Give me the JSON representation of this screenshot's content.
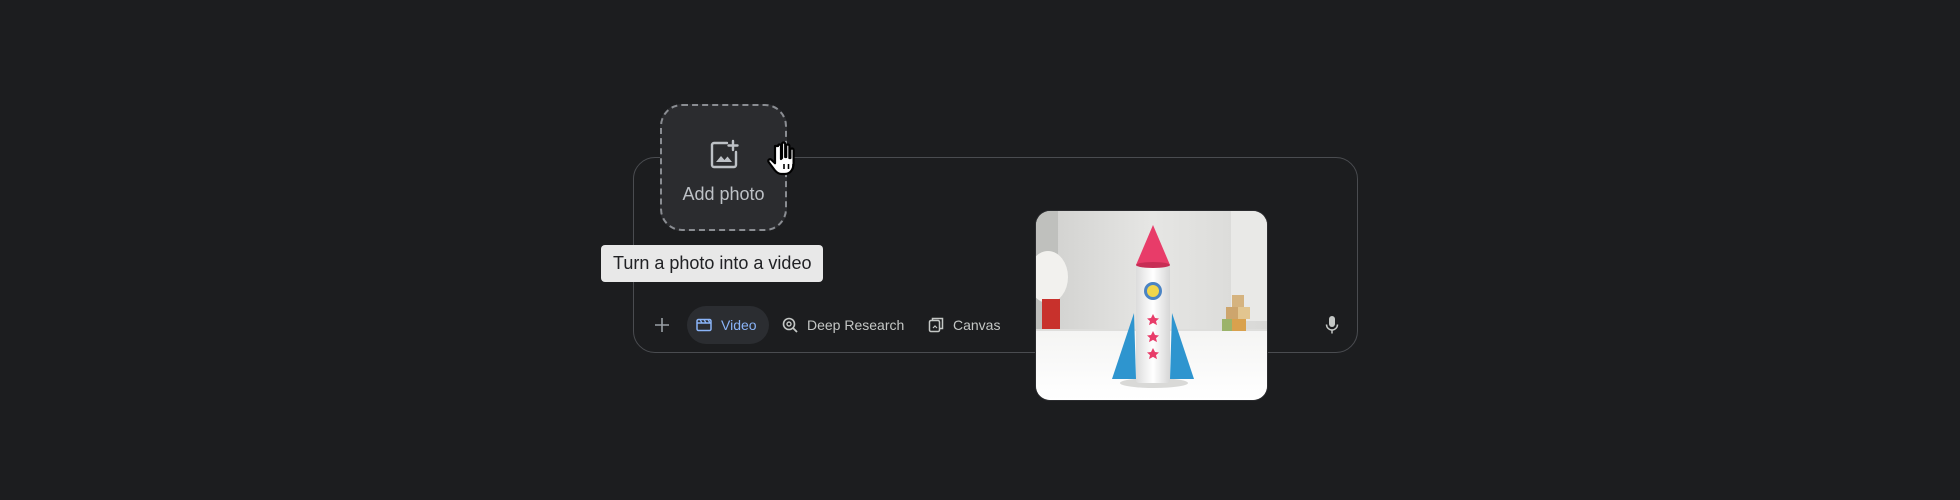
{
  "add_photo": {
    "label": "Add photo",
    "icon": "add-photo-icon"
  },
  "tooltip": {
    "text": "Turn a photo into a video"
  },
  "toolbar": {
    "add_icon": "plus-icon",
    "chips": [
      {
        "label": "Video",
        "icon": "video-icon",
        "active": true
      },
      {
        "label": "Deep Research",
        "icon": "deep-research-icon",
        "active": false
      },
      {
        "label": "Canvas",
        "icon": "canvas-icon",
        "active": false
      }
    ],
    "mic_icon": "mic-icon"
  },
  "colors": {
    "background": "#1c1d1f",
    "active_chip_text": "#8ab4f8",
    "tooltip_bg": "#e8e8e8"
  }
}
